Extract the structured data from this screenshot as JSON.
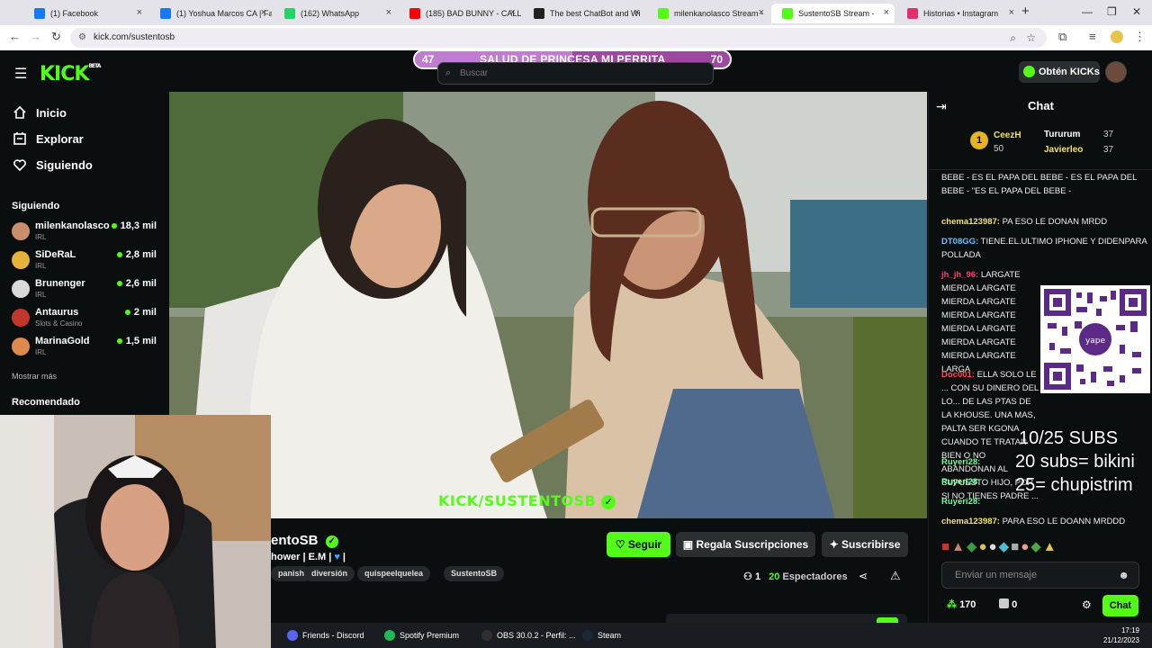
{
  "browser": {
    "tabs": [
      {
        "title": "(1) Facebook",
        "color": "#1877f2"
      },
      {
        "title": "(1) Yoshua Marcos CA | Fa",
        "color": "#1877f2"
      },
      {
        "title": "(162) WhatsApp",
        "color": "#25d366"
      },
      {
        "title": "(185) BAD BUNNY - CALL",
        "color": "#ff0000"
      },
      {
        "title": "The best ChatBot and Wi",
        "color": "#222222"
      },
      {
        "title": "milenkanolasco Stream -",
        "color": "#53fc18"
      },
      {
        "title": "SustentoSB Stream -",
        "color": "#53fc18",
        "active": true
      },
      {
        "title": "Historias • Instagram",
        "color": "#e1306c"
      }
    ],
    "new_tab": "+",
    "url": "kick.com/sustentosb"
  },
  "kick": {
    "logo": "KICK",
    "logo_sup": "BETA",
    "nav": [
      {
        "label": "Inicio",
        "icon": "home-icon"
      },
      {
        "label": "Explorar",
        "icon": "browse-icon"
      },
      {
        "label": "Siguiendo",
        "icon": "heart-icon"
      }
    ],
    "following_title": "Siguiendo",
    "following": [
      {
        "name": "milenkanolasco",
        "category": "IRL",
        "viewers": "18,3 mil",
        "color": "#c98f6d"
      },
      {
        "name": "SiDeRaL",
        "category": "IRL",
        "viewers": "2,8 mil",
        "color": "#e3b33a"
      },
      {
        "name": "Brunenger",
        "category": "IRL",
        "viewers": "2,6 mil",
        "color": "#d9d9d9"
      },
      {
        "name": "Antaurus",
        "category": "Slots & Casino",
        "viewers": "2 mil",
        "color": "#c2362b"
      },
      {
        "name": "MarinaGold",
        "category": "IRL",
        "viewers": "1,5 mil",
        "color": "#e0894e"
      }
    ],
    "show_more": "Mostrar más",
    "recommended_title": "Recomendado",
    "search_placeholder": "Buscar",
    "get_kicks": "Obtén KICKs",
    "goal": {
      "min": "47",
      "title": "SALUD DE PRINCESA MI PERRITA",
      "max": "70",
      "progress": 0.5
    },
    "video_watermark": "KICK/SUSTENTOSB",
    "stream": {
      "channel": "entoSB",
      "subtitle": "hower | E.M |",
      "tags": [
        "panish",
        "diversión",
        "quispeelquelea",
        "SustentoSB"
      ],
      "follow": "Seguir",
      "gift_subs": "Regala Suscripciones",
      "subscribe": "Suscribirse",
      "viewers_label": "Espectadores",
      "viewers": "20",
      "clips": "1"
    },
    "chat": {
      "title": "Chat",
      "leaders": [
        {
          "name": "CeezH",
          "value": "50"
        },
        {
          "name": "Tururum",
          "value": "37"
        },
        {
          "name": "Javierleo",
          "value": "37"
        }
      ],
      "messages": [
        {
          "user": "",
          "text": "BEBE - ES EL PAPA DEL BEBE - ES EL PAPA DEL BEBE - \"ES EL PAPA DEL BEBE -",
          "color": "#ffffff"
        },
        {
          "user": "chema123987:",
          "text": "PA ESO LE DONAN MRDD",
          "color": "#f2e36b"
        },
        {
          "user": "DT08GG:",
          "text": "TIENE.EL.ULTIMO IPHONE Y DIDENPARA POLLADA",
          "color": "#6bc0ff"
        },
        {
          "user": "jh_jh_96:",
          "text": "LARGATE MIERDA LARGATE MIERDA LARGATE MIERDA LARGATE MIERDA LARGATE MIERDA LARGATE MIERDA LARGATE LARGA",
          "color": "#ff3b6b"
        },
        {
          "user": "Doc001:",
          "text": "ELLA SOLO LE ... CON SU DINERO DEL LO... DE LAS PTAS DE LA KHOUSE. UNA MAS, PALTA SER KGONA CUANDO TE TRATAN BIEN O NO ABANDONAN AL SUPUESTO HIJO, POR SI NO TIENES PADRE ...",
          "color": "#ff4d4d"
        },
        {
          "user": "Ruyeri28:",
          "text": "",
          "color": "#6bff9a"
        },
        {
          "user": "Ruyeri28:",
          "text": "",
          "color": "#6bff9a"
        },
        {
          "user": "Ruyeri28:",
          "text": "",
          "color": "#6bff9a"
        },
        {
          "user": "chema123987:",
          "text": "PARA ESO LE DOANN MRDDD",
          "color": "#f2e36b"
        }
      ],
      "overlay_lines": [
        "10/25 SUBS",
        "20 subs= bikini",
        "25= chupistrim"
      ],
      "input_placeholder": "Enviar un mensaje",
      "points": "170",
      "count": "0",
      "send": "Chat"
    }
  },
  "taskbar": {
    "items": [
      {
        "label": "Friends - Discord",
        "color": "#5865f2"
      },
      {
        "label": "Spotify Premium",
        "color": "#1db954"
      },
      {
        "label": "OBS 30.0.2 - Perfil: ...",
        "color": "#302e31"
      },
      {
        "label": "Steam",
        "color": "#1b2838"
      }
    ],
    "time": "17:19",
    "date": "21/12/2023"
  }
}
